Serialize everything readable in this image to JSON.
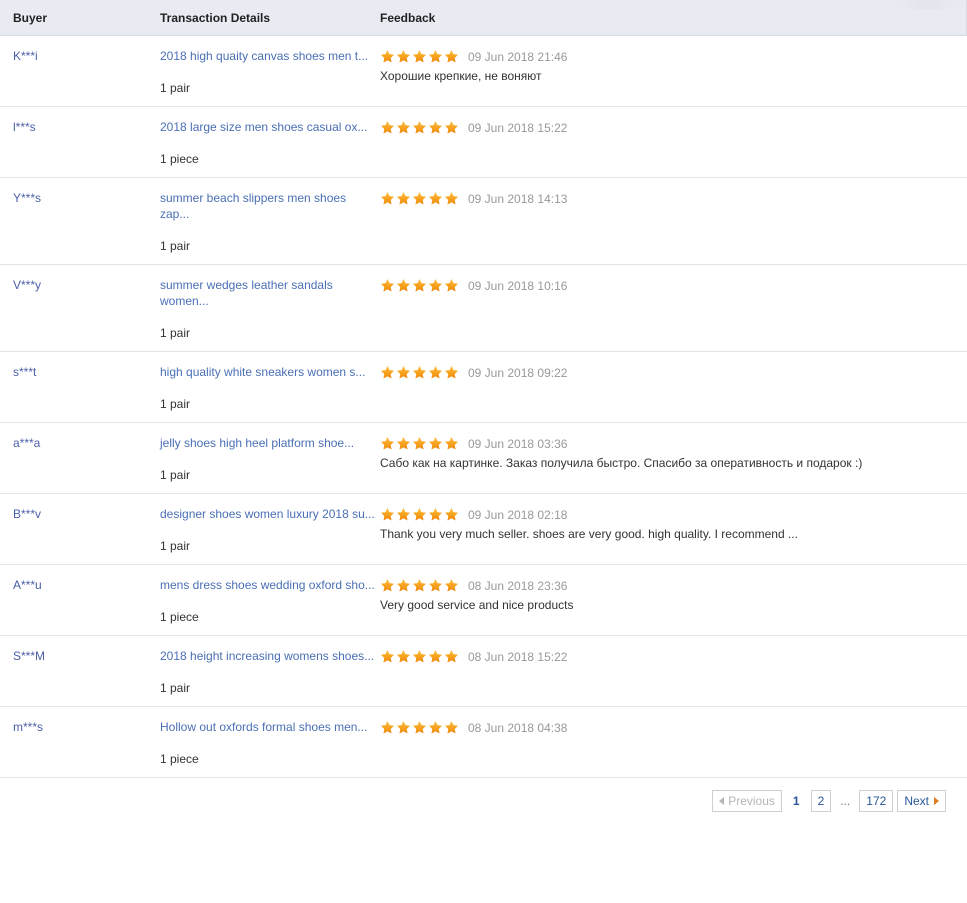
{
  "table": {
    "columns": {
      "buyer": "Buyer",
      "details": "Transaction Details",
      "feedback": "Feedback"
    },
    "rows": [
      {
        "buyer": "K***i",
        "title": "2018 high quaity canvas shoes men t...",
        "qty": "1 pair",
        "stars": 5,
        "date": "09 Jun 2018 21:46",
        "comment": "Хорошие крепкие, не воняют"
      },
      {
        "buyer": "l***s",
        "title": "2018 large size men shoes casual ox...",
        "qty": "1 piece",
        "stars": 5,
        "date": "09 Jun 2018 15:22",
        "comment": ""
      },
      {
        "buyer": "Y***s",
        "title": "summer beach slippers men shoes zap...",
        "qty": "1 pair",
        "stars": 5,
        "date": "09 Jun 2018 14:13",
        "comment": ""
      },
      {
        "buyer": "V***y",
        "title": "summer wedges leather sandals women...",
        "qty": "1 pair",
        "stars": 5,
        "date": "09 Jun 2018 10:16",
        "comment": ""
      },
      {
        "buyer": "s***t",
        "title": "high quality white sneakers women s...",
        "qty": "1 pair",
        "stars": 5,
        "date": "09 Jun 2018 09:22",
        "comment": ""
      },
      {
        "buyer": "a***a",
        "title": "jelly shoes high heel platform shoe...",
        "qty": "1 pair",
        "stars": 5,
        "date": "09 Jun 2018 03:36",
        "comment": "Сабо как на картинке. Заказ получила быстро. Спасибо за оперативность и подарок :)"
      },
      {
        "buyer": "B***v",
        "title": "designer shoes women luxury 2018 su...",
        "qty": "1 pair",
        "stars": 5,
        "date": "09 Jun 2018 02:18",
        "comment": "Thank you very much seller. shoes are very good. high quality. I recommend ..."
      },
      {
        "buyer": "A***u",
        "title": "mens dress shoes wedding oxford sho...",
        "qty": "1 piece",
        "stars": 5,
        "date": "08 Jun 2018 23:36",
        "comment": "Very good service and nice products"
      },
      {
        "buyer": "S***M",
        "title": "2018 height increasing womens shoes...",
        "qty": "1 pair",
        "stars": 5,
        "date": "08 Jun 2018 15:22",
        "comment": ""
      },
      {
        "buyer": "m***s",
        "title": "Hollow out oxfords formal shoes men...",
        "qty": "1 piece",
        "stars": 5,
        "date": "08 Jun 2018 04:38",
        "comment": ""
      }
    ]
  },
  "pagination": {
    "previous_label": "Previous",
    "next_label": "Next",
    "ellipsis": "...",
    "pages": [
      "1",
      "2",
      "172"
    ],
    "current_page": "1"
  },
  "colors": {
    "header_bg": "#e9ebf2",
    "link": "#4a6fb5",
    "buyer_link": "#4c5fa8",
    "star": "#f5a623",
    "date": "#999999",
    "pager_link": "#2a5699",
    "pager_disabled": "#b5b5b5",
    "next_arrow": "#e07b20"
  },
  "icons": {
    "star": "star-icon",
    "prev_arrow": "triangle-left-icon",
    "next_arrow": "triangle-right-icon"
  }
}
